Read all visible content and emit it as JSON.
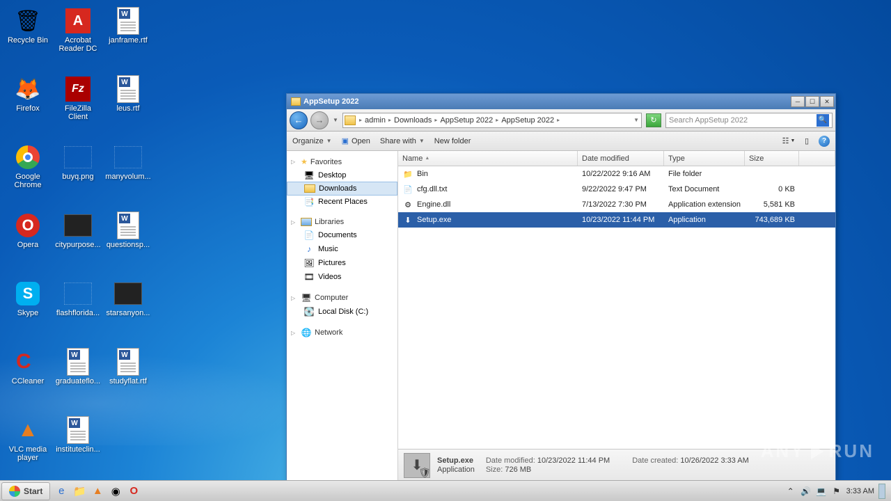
{
  "desktop": {
    "icons": [
      {
        "label": "Recycle Bin",
        "glyph": "🗑",
        "type": "sys"
      },
      {
        "label": "Acrobat Reader DC",
        "glyph": "A",
        "type": "acro"
      },
      {
        "label": "janframe.rtf",
        "type": "word"
      },
      {
        "label": "Firefox",
        "glyph": "🦊",
        "type": "sys"
      },
      {
        "label": "FileZilla Client",
        "glyph": "Fz",
        "type": "fz"
      },
      {
        "label": "leus.rtf",
        "type": "word"
      },
      {
        "label": "Google Chrome",
        "glyph": "◉",
        "type": "chrome"
      },
      {
        "label": "buyq.png",
        "type": "blank"
      },
      {
        "label": "manyvolum...",
        "type": "blank"
      },
      {
        "label": "Opera",
        "glyph": "O",
        "type": "opera"
      },
      {
        "label": "citypurpose...",
        "type": "imgblack"
      },
      {
        "label": "questionsp...",
        "type": "word"
      },
      {
        "label": "Skype",
        "glyph": "S",
        "type": "skype"
      },
      {
        "label": "flashflorida...",
        "type": "blank"
      },
      {
        "label": "starsanyon...",
        "type": "imgblack"
      },
      {
        "label": "CCleaner",
        "glyph": "C",
        "type": "cc"
      },
      {
        "label": "graduateflo...",
        "type": "word"
      },
      {
        "label": "studyflat.rtf",
        "type": "word"
      },
      {
        "label": "VLC media player",
        "glyph": "▲",
        "type": "vlc"
      },
      {
        "label": "instituteclin...",
        "type": "word"
      }
    ]
  },
  "window": {
    "title": "AppSetup 2022",
    "breadcrumbs": [
      "admin",
      "Downloads",
      "AppSetup 2022",
      "AppSetup 2022"
    ],
    "search_placeholder": "Search AppSetup 2022",
    "toolbar": {
      "organize": "Organize",
      "open": "Open",
      "share": "Share with",
      "newfolder": "New folder"
    },
    "nav": {
      "favorites": {
        "label": "Favorites",
        "items": [
          "Desktop",
          "Downloads",
          "Recent Places"
        ],
        "selected": "Downloads"
      },
      "libraries": {
        "label": "Libraries",
        "items": [
          "Documents",
          "Music",
          "Pictures",
          "Videos"
        ]
      },
      "computer": {
        "label": "Computer",
        "items": [
          "Local Disk (C:)"
        ]
      },
      "network": {
        "label": "Network"
      }
    },
    "columns": {
      "name": "Name",
      "date": "Date modified",
      "type": "Type",
      "size": "Size"
    },
    "files": [
      {
        "name": "Bin",
        "date": "10/22/2022 9:16 AM",
        "type": "File folder",
        "size": "",
        "icon": "folder"
      },
      {
        "name": "cfg.dll.txt",
        "date": "9/22/2022 9:47 PM",
        "type": "Text Document",
        "size": "0 KB",
        "icon": "txt"
      },
      {
        "name": "Engine.dll",
        "date": "7/13/2022 7:30 PM",
        "type": "Application extension",
        "size": "5,581 KB",
        "icon": "dll"
      },
      {
        "name": "Setup.exe",
        "date": "10/23/2022 11:44 PM",
        "type": "Application",
        "size": "743,689 KB",
        "icon": "exe",
        "selected": true
      }
    ],
    "details": {
      "name": "Setup.exe",
      "type": "Application",
      "mod_k": "Date modified:",
      "mod_v": "10/23/2022 11:44 PM",
      "size_k": "Size:",
      "size_v": "726 MB",
      "created_k": "Date created:",
      "created_v": "10/26/2022 3:33 AM"
    }
  },
  "taskbar": {
    "start": "Start",
    "time": "3:33 AM"
  },
  "watermark": {
    "a": "ANY",
    "b": "RUN"
  }
}
